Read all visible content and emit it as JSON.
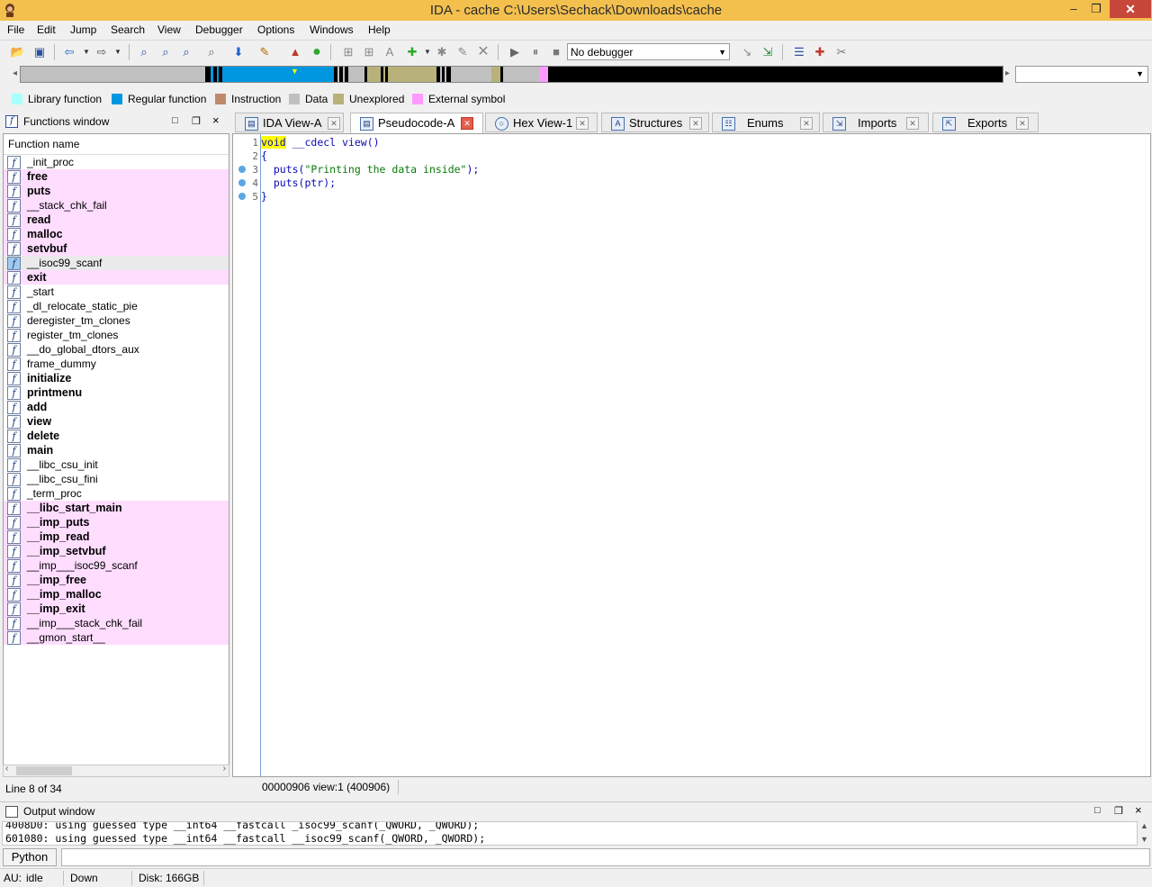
{
  "window": {
    "title": "IDA - cache C:\\Users\\Sechack\\Downloads\\cache",
    "minimize": "–",
    "restore": "❐",
    "close": "✕"
  },
  "menu": [
    "File",
    "Edit",
    "Jump",
    "Search",
    "View",
    "Debugger",
    "Options",
    "Windows",
    "Help"
  ],
  "toolbar": {
    "debugger_select": "No debugger"
  },
  "legend": [
    {
      "label": "Library function",
      "color": "#aaffff"
    },
    {
      "label": "Regular function",
      "color": "#0097e0"
    },
    {
      "label": "Instruction",
      "color": "#c08a6a"
    },
    {
      "label": "Data",
      "color": "#c0c0c0"
    },
    {
      "label": "Unexplored",
      "color": "#b8b27a"
    },
    {
      "label": "External symbol",
      "color": "#ff99ff"
    }
  ],
  "functions_window": {
    "title": "Functions window",
    "column_header": "Function name",
    "line_info": "Line 8 of 34",
    "items": [
      {
        "name": "_init_proc",
        "lib": false,
        "bold": false
      },
      {
        "name": "free",
        "lib": true,
        "bold": true
      },
      {
        "name": "puts",
        "lib": true,
        "bold": true
      },
      {
        "name": "__stack_chk_fail",
        "lib": true,
        "bold": false
      },
      {
        "name": "read",
        "lib": true,
        "bold": true
      },
      {
        "name": "malloc",
        "lib": true,
        "bold": true
      },
      {
        "name": "setvbuf",
        "lib": true,
        "bold": true
      },
      {
        "name": "__isoc99_scanf",
        "lib": false,
        "bold": false,
        "selected": true
      },
      {
        "name": "exit",
        "lib": true,
        "bold": true
      },
      {
        "name": "_start",
        "lib": false,
        "bold": false
      },
      {
        "name": "_dl_relocate_static_pie",
        "lib": false,
        "bold": false
      },
      {
        "name": "deregister_tm_clones",
        "lib": false,
        "bold": false
      },
      {
        "name": "register_tm_clones",
        "lib": false,
        "bold": false
      },
      {
        "name": "__do_global_dtors_aux",
        "lib": false,
        "bold": false
      },
      {
        "name": "frame_dummy",
        "lib": false,
        "bold": false
      },
      {
        "name": "initialize",
        "lib": false,
        "bold": true
      },
      {
        "name": "printmenu",
        "lib": false,
        "bold": true
      },
      {
        "name": "add",
        "lib": false,
        "bold": true
      },
      {
        "name": "view",
        "lib": false,
        "bold": true
      },
      {
        "name": "delete",
        "lib": false,
        "bold": true
      },
      {
        "name": "main",
        "lib": false,
        "bold": true
      },
      {
        "name": "__libc_csu_init",
        "lib": false,
        "bold": false
      },
      {
        "name": "__libc_csu_fini",
        "lib": false,
        "bold": false
      },
      {
        "name": "_term_proc",
        "lib": false,
        "bold": false
      },
      {
        "name": "__libc_start_main",
        "lib": true,
        "bold": true
      },
      {
        "name": "__imp_puts",
        "lib": true,
        "bold": true
      },
      {
        "name": "__imp_read",
        "lib": true,
        "bold": true
      },
      {
        "name": "__imp_setvbuf",
        "lib": true,
        "bold": true
      },
      {
        "name": "__imp___isoc99_scanf",
        "lib": true,
        "bold": false
      },
      {
        "name": "__imp_free",
        "lib": true,
        "bold": true
      },
      {
        "name": "__imp_malloc",
        "lib": true,
        "bold": true
      },
      {
        "name": "__imp_exit",
        "lib": true,
        "bold": true
      },
      {
        "name": "__imp___stack_chk_fail",
        "lib": true,
        "bold": false
      },
      {
        "name": "__gmon_start__",
        "lib": true,
        "bold": false
      }
    ]
  },
  "tabs": [
    {
      "label": "IDA View-A",
      "icon": "ida-view",
      "active": false
    },
    {
      "label": "Pseudocode-A",
      "icon": "pseudocode",
      "active": true
    },
    {
      "label": "Hex View-1",
      "icon": "hex",
      "active": false
    },
    {
      "label": "Structures",
      "icon": "structures",
      "active": false
    },
    {
      "label": "Enums",
      "icon": "enums",
      "active": false
    },
    {
      "label": "Imports",
      "icon": "imports",
      "active": false
    },
    {
      "label": "Exports",
      "icon": "exports",
      "active": false
    }
  ],
  "pseudocode": {
    "lines": [
      {
        "num": "1",
        "bp": false,
        "parts": [
          {
            "t": "void",
            "c": "kw"
          },
          {
            "t": " __cdecl view()",
            "c": "fn"
          }
        ]
      },
      {
        "num": "2",
        "bp": false,
        "parts": [
          {
            "t": "{",
            "c": "plain"
          }
        ]
      },
      {
        "num": "3",
        "bp": true,
        "parts": [
          {
            "t": "  puts(",
            "c": "fn"
          },
          {
            "t": "\"Printing the data inside\"",
            "c": "str"
          },
          {
            "t": ");",
            "c": "fn"
          }
        ]
      },
      {
        "num": "4",
        "bp": true,
        "parts": [
          {
            "t": "  puts(ptr);",
            "c": "fn"
          }
        ]
      },
      {
        "num": "5",
        "bp": true,
        "parts": [
          {
            "t": "}",
            "c": "plain"
          }
        ]
      }
    ],
    "status": "00000906 view:1 (400906)"
  },
  "output_window": {
    "title": "Output window",
    "lines": [
      "4008D0: using guessed type __int64 __fastcall _isoc99_scanf(_QWORD, _QWORD);",
      "601080: using guessed type __int64 __fastcall __isoc99_scanf(_QWORD, _QWORD);"
    ],
    "python_button": "Python"
  },
  "statusbar": {
    "au": "AU:",
    "state": "idle",
    "direction": "Down",
    "disk": "Disk: 166GB"
  }
}
